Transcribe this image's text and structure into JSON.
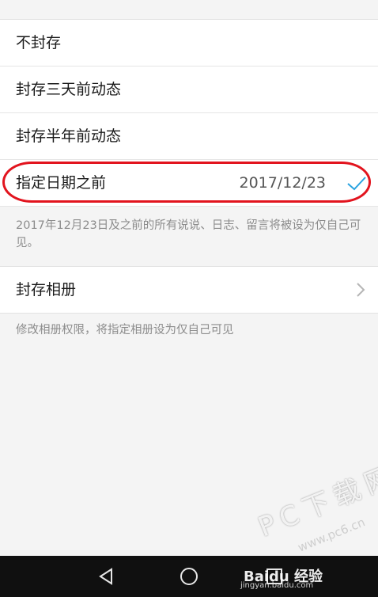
{
  "options": [
    {
      "label": "不封存",
      "value": "",
      "selected": false
    },
    {
      "label": "封存三天前动态",
      "value": "",
      "selected": false
    },
    {
      "label": "封存半年前动态",
      "value": "",
      "selected": false
    },
    {
      "label": "指定日期之前",
      "value": "2017/12/23",
      "selected": true
    }
  ],
  "date_hint": "2017年12月23日及之前的所有说说、日志、留言将被设为仅自己可见。",
  "album": {
    "label": "封存相册",
    "hint": "修改相册权限，将指定相册设为仅自己可见"
  },
  "watermarks": {
    "pc_site": "PC下载网",
    "pc_url": "www.pc6.cn",
    "baidu_brand": "Baidu 经验",
    "baidu_url": "jingyan.baidu.com"
  },
  "colors": {
    "accent_check": "#2aa3e0",
    "highlight_oval": "#e2141e",
    "navbar": "#101010"
  },
  "icons": {
    "selected": "check-icon",
    "album_open": "chevron-right-icon",
    "nav_back": "back-triangle-icon",
    "nav_home": "home-circle-icon",
    "nav_recent": "recent-square-icon"
  }
}
